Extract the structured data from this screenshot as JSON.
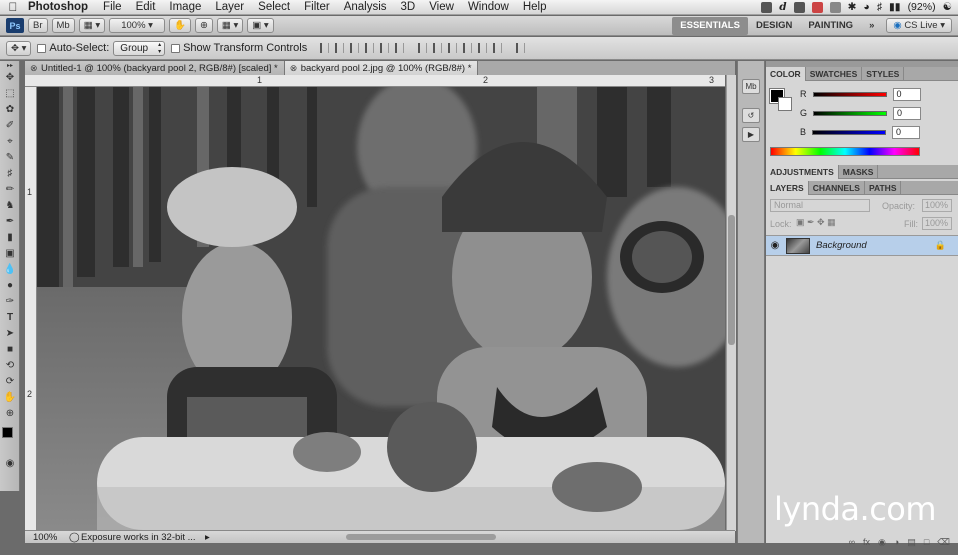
{
  "menubar": {
    "app": "Photoshop",
    "items": [
      "File",
      "Edit",
      "Image",
      "Layer",
      "Select",
      "Filter",
      "Analysis",
      "3D",
      "View",
      "Window",
      "Help"
    ],
    "battery": "(92%)"
  },
  "appbar": {
    "zoom": "100%",
    "workspaces": [
      "ESSENTIALS",
      "DESIGN",
      "PAINTING"
    ],
    "more": "»",
    "cslive": "CS Live"
  },
  "options": {
    "auto_select_label": "Auto-Select:",
    "auto_select_value": "Group",
    "transform_label": "Show Transform Controls"
  },
  "tabs": [
    {
      "label": "Untitled-1 @ 100% (backyard pool 2, RGB/8#) [scaled]",
      "active": false
    },
    {
      "label": "backyard pool 2.jpg @ 100% (RGB/8#)",
      "active": true
    }
  ],
  "rulers": {
    "h": [
      "1",
      "2",
      "3"
    ],
    "v": [
      "1",
      "2"
    ]
  },
  "status": {
    "zoom": "100%",
    "message": "Exposure works in 32-bit ..."
  },
  "color_panel": {
    "tabs": [
      "COLOR",
      "SWATCHES",
      "STYLES"
    ],
    "r": "0",
    "g": "0",
    "b": "0"
  },
  "adjust_panel": {
    "tabs": [
      "ADJUSTMENTS",
      "MASKS"
    ]
  },
  "layers_panel": {
    "tabs": [
      "LAYERS",
      "CHANNELS",
      "PATHS"
    ],
    "blend": "Normal",
    "opacity_label": "Opacity:",
    "opacity": "100%",
    "lock_label": "Lock:",
    "fill_label": "Fill:",
    "fill": "100%",
    "layer_name": "Background"
  },
  "watermark": "lynda.com"
}
